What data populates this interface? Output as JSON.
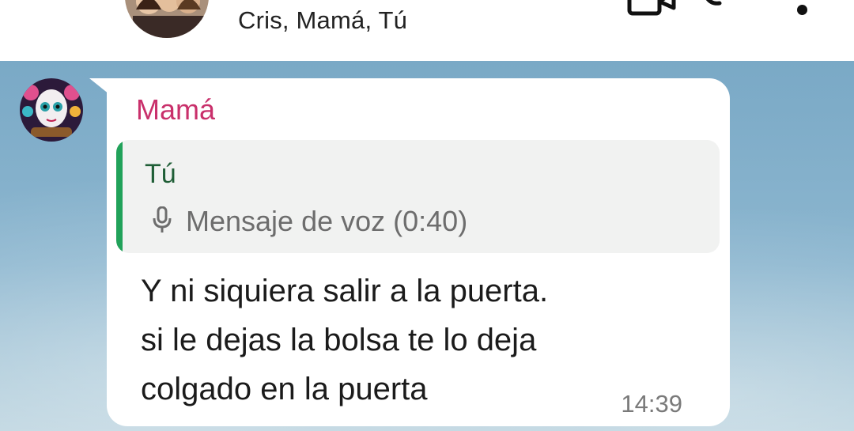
{
  "header": {
    "members": "Cris, Mamá, Tú"
  },
  "message": {
    "sender": "Mamá",
    "sender_color": "#c9306b",
    "reply": {
      "author": "Tú",
      "icon": "microphone-icon",
      "text": "Mensaje de voz (0:40)",
      "accent_color": "#21a25a"
    },
    "lines": [
      "Y ni siquiera salir a la puerta.",
      "si le dejas la bolsa te lo deja",
      "colgado en la puerta"
    ],
    "time": "14:39"
  }
}
